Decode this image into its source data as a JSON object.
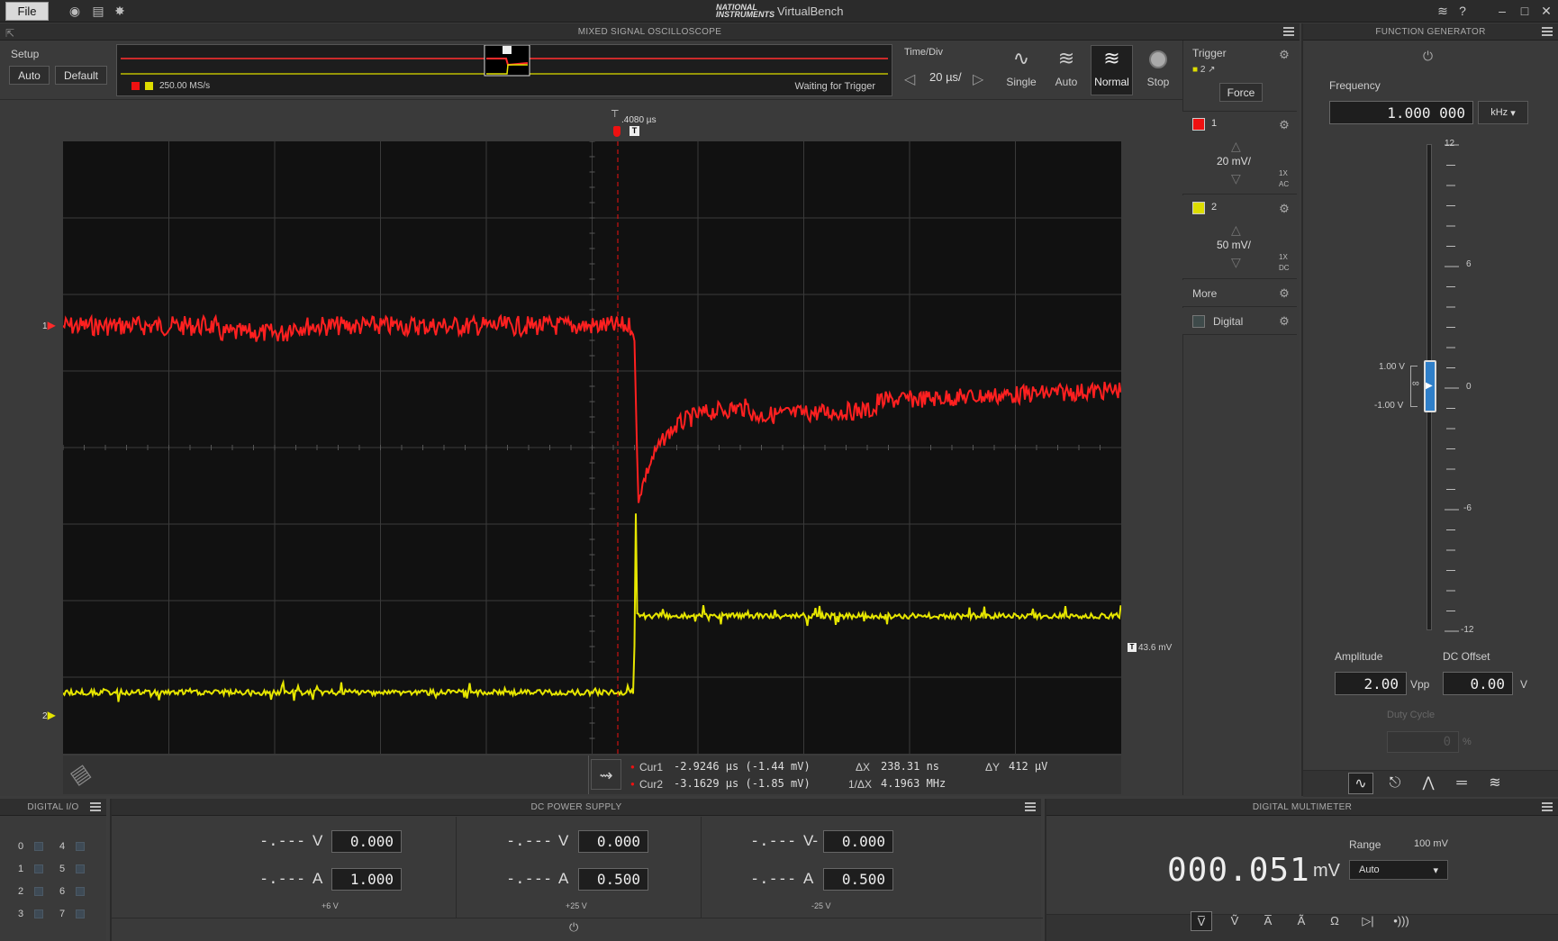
{
  "app": {
    "title": "VirtualBench",
    "brand": "NATIONAL INSTRUMENTS",
    "file_label": "File"
  },
  "scope": {
    "header": "MIXED SIGNAL OSCILLOSCOPE",
    "setup_label": "Setup",
    "auto_label": "Auto",
    "default_label": "Default",
    "sample_rate": "250.00 MS/s",
    "status": "Waiting for Trigger",
    "timediv_label": "Time/Div",
    "timediv_value": "20 µs/",
    "modes": [
      {
        "label": "Single"
      },
      {
        "label": "Auto"
      },
      {
        "label": "Normal"
      },
      {
        "label": "Stop"
      }
    ],
    "trigger_time": ".4080 µs",
    "ref_level": "43.6 mV",
    "ch1_marker": "1",
    "ch2_marker": "2",
    "colors": {
      "ch1": "#ff2020",
      "ch2": "#e6e600"
    },
    "cursors": {
      "cur1_label": "Cur1",
      "cur1_value": "-2.9246 µs (-1.44 mV)",
      "cur2_label": "Cur2",
      "cur2_value": "-3.1629 µs (-1.85 mV)",
      "dx_label": "ΔX",
      "dx_value": "238.31 ns",
      "inv_dx_label": "1/ΔX",
      "inv_dx_value": "4.1963 MHz",
      "dy_label": "ΔY",
      "dy_value": "412 µV"
    }
  },
  "trigger": {
    "label": "Trigger",
    "source": "2",
    "force_label": "Force"
  },
  "channels": [
    {
      "name": "1",
      "scale": "20 mV/",
      "probe": "1X",
      "coupling": "AC",
      "color": "#ff2020"
    },
    {
      "name": "2",
      "scale": "50 mV/",
      "probe": "1X",
      "coupling": "DC",
      "color": "#e6e600"
    }
  ],
  "more_label": "More",
  "digital_label": "Digital",
  "fgen": {
    "header": "FUNCTION GENERATOR",
    "freq_label": "Frequency",
    "freq_value": "1.000 000",
    "freq_unit": "kHz",
    "scale_labels": [
      "12",
      "6",
      "0",
      "-6",
      "-12"
    ],
    "upper_label": "1.00 V",
    "lower_label": "-1.00 V",
    "amp_label": "Amplitude",
    "amp_value": "2.00",
    "amp_unit": "Vpp",
    "offset_label": "DC Offset",
    "offset_value": "0.00",
    "offset_unit": "V",
    "duty_label": "Duty Cycle",
    "duty_value": "0",
    "duty_unit": "%"
  },
  "dio": {
    "header": "DIGITAL I/O",
    "pins": [
      "0",
      "4",
      "1",
      "5",
      "2",
      "6",
      "3",
      "7"
    ]
  },
  "psu": {
    "header": "DC POWER SUPPLY",
    "channels": [
      {
        "v_read": "-.---",
        "v_unit": "V",
        "v_set": "0.000",
        "a_read": "-.---",
        "a_unit": "A",
        "a_set": "1.000",
        "label": "+6 V"
      },
      {
        "v_read": "-.---",
        "v_unit": "V",
        "v_set": "0.000",
        "a_read": "-.---",
        "a_unit": "A",
        "a_set": "0.500",
        "label": "+25 V"
      },
      {
        "v_read": "-.---",
        "v_unit": "V-",
        "v_set": "0.000",
        "a_read": "-.---",
        "a_unit": "A",
        "a_set": "0.500",
        "label": "-25 V"
      }
    ]
  },
  "dmm": {
    "header": "DIGITAL MULTIMETER",
    "value": "000.051",
    "unit": "mV",
    "range_label": "Range",
    "range_value": "100 mV",
    "range_mode": "Auto"
  }
}
